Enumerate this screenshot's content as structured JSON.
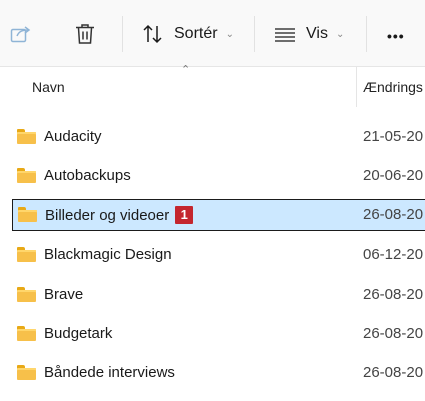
{
  "toolbar": {
    "share_icon": "share-icon",
    "delete_icon": "trash-icon",
    "sort_label": "Sortér",
    "view_label": "Vis",
    "more_label": "•••"
  },
  "columns": {
    "name": "Navn",
    "date": "Ændrings"
  },
  "rows": [
    {
      "name": "Audacity",
      "date": "21-05-20"
    },
    {
      "name": "Autobackups",
      "date": "20-06-20"
    },
    {
      "name": "Billeder og videoer",
      "date": "26-08-20",
      "selected": true,
      "badge": "1"
    },
    {
      "name": "Blackmagic Design",
      "date": "06-12-20"
    },
    {
      "name": "Brave",
      "date": "26-08-20"
    },
    {
      "name": "Budgetark",
      "date": "26-08-20"
    },
    {
      "name": "Båndede interviews",
      "date": "26-08-20"
    }
  ],
  "colors": {
    "selection": "#cce8ff",
    "folder": "#f7c04a",
    "badge": "#c4262e"
  }
}
